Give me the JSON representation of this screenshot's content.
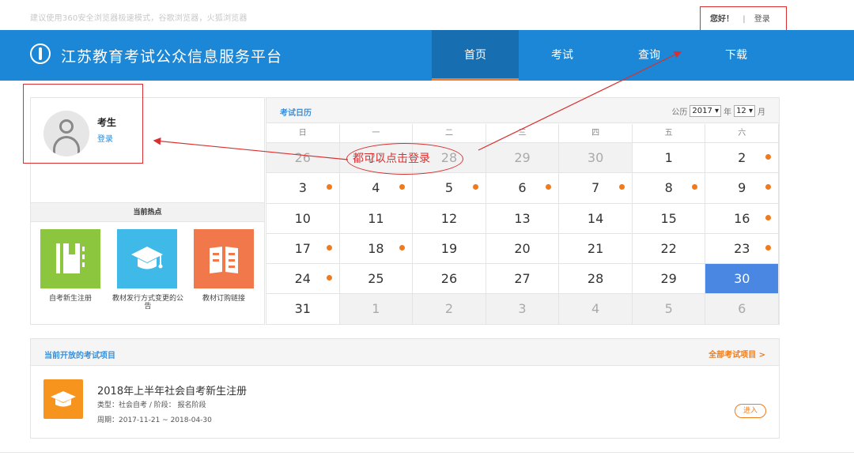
{
  "tipbar": {
    "tip": "建议使用360安全浏览器极速模式，谷歌浏览器，火狐浏览器",
    "hello": "您好！",
    "separator": "|",
    "login": "登录"
  },
  "header": {
    "title": "江苏教育考试公众信息服务平台",
    "nav": [
      {
        "label": "首页",
        "active": true
      },
      {
        "label": "考试"
      },
      {
        "label": "查询"
      },
      {
        "label": "下载"
      }
    ]
  },
  "profile": {
    "name": "考生",
    "login": "登录"
  },
  "hot": {
    "title": "当前热点",
    "tiles": [
      {
        "label": "自考新生注册",
        "color": "#8cc63f",
        "icon": "notebook-icon"
      },
      {
        "label": "教材发行方式变更的公告",
        "color": "#3fb9e8",
        "icon": "graduation-cap-icon"
      },
      {
        "label": "教材订购链接",
        "color": "#f0784a",
        "icon": "open-book-icon"
      }
    ]
  },
  "calendar": {
    "title": "考试日历",
    "calendar_label": "公历",
    "year": "2017",
    "year_unit": "年",
    "month": "12",
    "month_unit": "月",
    "weekdays": [
      "日",
      "一",
      "二",
      "三",
      "四",
      "五",
      "六"
    ],
    "rows": [
      [
        {
          "d": "26",
          "other": true
        },
        {
          "d": "27",
          "other": true
        },
        {
          "d": "28",
          "other": true
        },
        {
          "d": "29",
          "other": true
        },
        {
          "d": "30",
          "other": true
        },
        {
          "d": "1"
        },
        {
          "d": "2",
          "dot": true
        }
      ],
      [
        {
          "d": "3",
          "dot": true
        },
        {
          "d": "4",
          "dot": true
        },
        {
          "d": "5",
          "dot": true
        },
        {
          "d": "6",
          "dot": true
        },
        {
          "d": "7",
          "dot": true
        },
        {
          "d": "8",
          "dot": true
        },
        {
          "d": "9",
          "dot": true
        }
      ],
      [
        {
          "d": "10"
        },
        {
          "d": "11"
        },
        {
          "d": "12"
        },
        {
          "d": "13"
        },
        {
          "d": "14"
        },
        {
          "d": "15"
        },
        {
          "d": "16",
          "dot": true
        }
      ],
      [
        {
          "d": "17",
          "dot": true
        },
        {
          "d": "18",
          "dot": true
        },
        {
          "d": "19"
        },
        {
          "d": "20"
        },
        {
          "d": "21"
        },
        {
          "d": "22"
        },
        {
          "d": "23",
          "dot": true
        }
      ],
      [
        {
          "d": "24",
          "dot": true
        },
        {
          "d": "25"
        },
        {
          "d": "26"
        },
        {
          "d": "27"
        },
        {
          "d": "28"
        },
        {
          "d": "29"
        },
        {
          "d": "30",
          "today": true
        }
      ],
      [
        {
          "d": "31"
        },
        {
          "d": "1",
          "other": true
        },
        {
          "d": "2",
          "other": true
        },
        {
          "d": "3",
          "other": true
        },
        {
          "d": "4",
          "other": true
        },
        {
          "d": "5",
          "other": true
        },
        {
          "d": "6",
          "other": true
        }
      ]
    ]
  },
  "annotation": {
    "text": "都可以点击登录"
  },
  "projects": {
    "title": "当前开放的考试项目",
    "more": "全部考试项目 >",
    "item": {
      "name": "2018年上半年社会自考新生注册",
      "meta1": "类型：社会自考 / 阶段： 报名阶段",
      "meta2": "周期：2017-11-21 ~ 2018-04-30",
      "enter": "进入"
    }
  },
  "colors": {
    "header": "#1b87d6",
    "accent": "#f07b1c",
    "today": "#4a87e2",
    "annotation": "#d83030"
  }
}
